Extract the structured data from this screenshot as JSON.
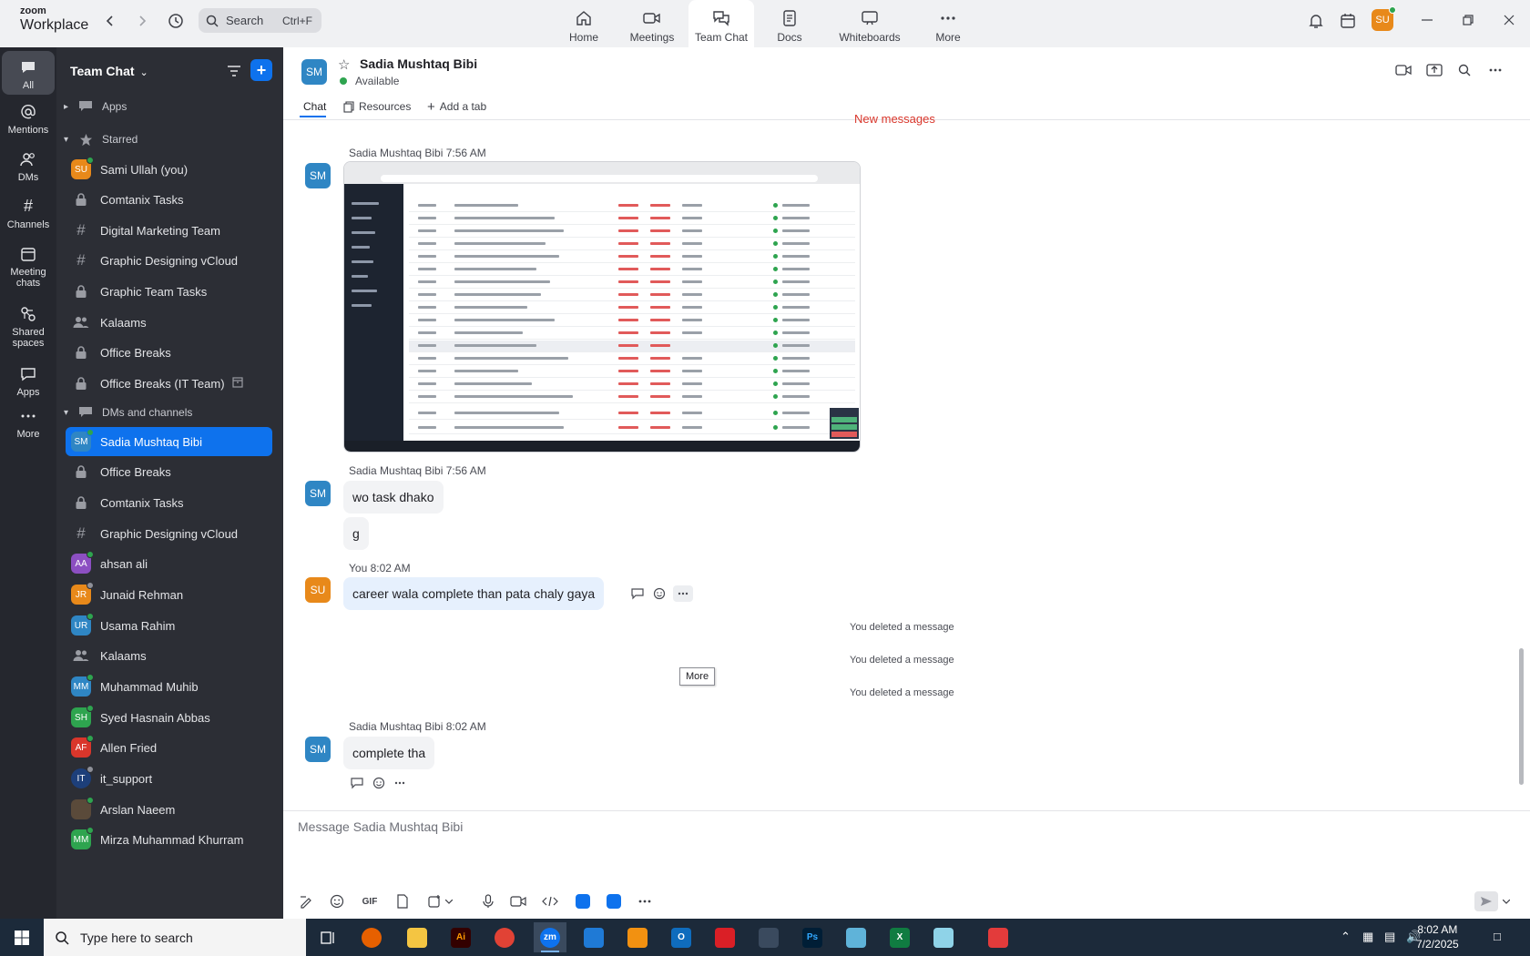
{
  "app": {
    "brand_top": "zoom",
    "brand_bottom": "Workplace",
    "search_label": "Search",
    "search_shortcut": "Ctrl+F",
    "user_initials": "SU"
  },
  "nav_tabs": [
    {
      "label": "Home"
    },
    {
      "label": "Meetings"
    },
    {
      "label": "Team Chat"
    },
    {
      "label": "Docs"
    },
    {
      "label": "Whiteboards"
    },
    {
      "label": "More"
    }
  ],
  "rail": [
    {
      "label": "All"
    },
    {
      "label": "Mentions"
    },
    {
      "label": "DMs"
    },
    {
      "label": "Channels"
    },
    {
      "label": "Meeting chats"
    },
    {
      "label": "Shared spaces"
    },
    {
      "label": "Apps"
    },
    {
      "label": "More"
    }
  ],
  "sidebar": {
    "title": "Team Chat",
    "sections": {
      "apps": "Apps",
      "starred": "Starred",
      "dms": "DMs and channels"
    },
    "starred": [
      {
        "label": "Sami Ullah (you)",
        "initials": "SU",
        "color": "#e8891a"
      },
      {
        "label": "Comtanix Tasks"
      },
      {
        "label": "Digital Marketing Team"
      },
      {
        "label": "Graphic Designing vCloud"
      },
      {
        "label": "Graphic Team Tasks"
      },
      {
        "label": "Kalaams"
      },
      {
        "label": "Office Breaks"
      },
      {
        "label": "Office Breaks (IT Team)"
      }
    ],
    "dms": [
      {
        "label": "Sadia Mushtaq Bibi",
        "initials": "SM",
        "color": "#2f86c4"
      },
      {
        "label": "Office Breaks"
      },
      {
        "label": "Comtanix Tasks"
      },
      {
        "label": "Graphic Designing vCloud"
      },
      {
        "label": "ahsan ali",
        "initials": "AA",
        "color": "#8c4fc2"
      },
      {
        "label": "Junaid Rehman",
        "initials": "JR",
        "color": "#e8891a"
      },
      {
        "label": "Usama Rahim",
        "initials": "UR",
        "color": "#2f86c4"
      },
      {
        "label": "Kalaams"
      },
      {
        "label": "Muhammad Muhib",
        "initials": "MM",
        "color": "#2f86c4"
      },
      {
        "label": "Syed Hasnain Abbas",
        "initials": "SH",
        "color": "#2ea44f"
      },
      {
        "label": "Allen Fried",
        "initials": "AF",
        "color": "#d9362b"
      },
      {
        "label": "it_support",
        "initials": "IT",
        "color": "#1d3f7a"
      },
      {
        "label": "Arslan Naeem",
        "initials": "",
        "color": "#5a4a3a"
      },
      {
        "label": "Mirza Muhammad Khurram",
        "initials": "MM",
        "color": "#2ea44f"
      }
    ]
  },
  "chat": {
    "contact_name": "Sadia Mushtaq Bibi",
    "contact_initials": "SM",
    "status": "Available",
    "tabs": [
      "Chat",
      "Resources",
      "Add a tab"
    ],
    "new_messages": "New messages",
    "messages": [
      {
        "sender": "Sadia Mushtaq Bibi",
        "time": "7:56 AM"
      },
      {
        "sender": "Sadia Mushtaq Bibi",
        "time": "7:56 AM",
        "lines": [
          "wo task dhako",
          "g"
        ]
      },
      {
        "sender": "You",
        "time": "8:02 AM",
        "text": "career wala complete than pata chaly gaya"
      },
      {
        "sender": "Sadia Mushtaq Bibi",
        "time": "8:02 AM",
        "text": "complete tha"
      }
    ],
    "deleted_text": "You deleted a message",
    "tooltip": "More",
    "composer_placeholder": "Message Sadia Mushtaq Bibi"
  },
  "taskbar": {
    "search_placeholder": "Type here to search",
    "time": "8:02 AM",
    "date": "7/2/2025"
  },
  "colors": {
    "accent": "#0e72ed",
    "rail_bg": "#25272e",
    "sidebar_bg": "#2c2e35",
    "online": "#2ea44f"
  }
}
